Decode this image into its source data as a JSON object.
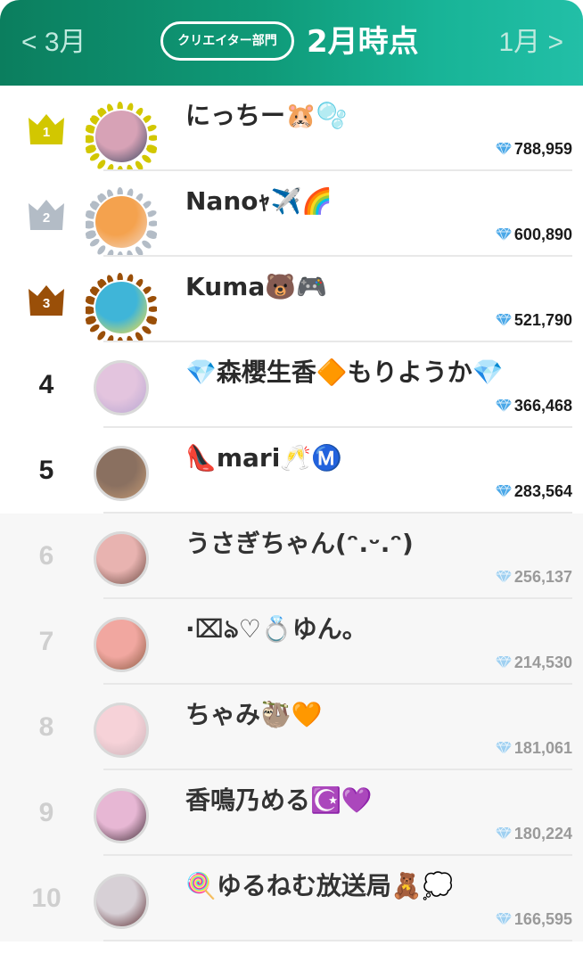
{
  "header": {
    "prev_label": "< 3月",
    "next_label": "1月 >",
    "badge_label": "クリエイター部門",
    "title": "2月時点"
  },
  "colors": {
    "header_gradient_start": "#0b7e5e",
    "header_gradient_end": "#22bfa7",
    "gold": "#d2c700",
    "silver": "#b3bcc6",
    "bronze": "#9a4f08",
    "gem": "#4aa8e8"
  },
  "ranking": [
    {
      "rank": "1",
      "name": "にっちー🐹🫧",
      "score": "788,959",
      "crown": "gold",
      "avatar_colors": [
        "#d7a2b6",
        "#3a4760"
      ]
    },
    {
      "rank": "2",
      "name": "Nanoｬ✈️🌈",
      "score": "600,890",
      "crown": "silver",
      "avatar_colors": [
        "#f4a24e",
        "#f2d7c5"
      ]
    },
    {
      "rank": "3",
      "name": "Kuma🐻🎮",
      "score": "521,790",
      "crown": "bronze",
      "avatar_colors": [
        "#3fb5d8",
        "#ffe23e"
      ]
    },
    {
      "rank": "4",
      "name": "💎森櫻生香🔶もりようか💎",
      "score": "366,468",
      "crown": "",
      "avatar_colors": [
        "#e3c4de",
        "#b7a6d2"
      ]
    },
    {
      "rank": "5",
      "name": "👠mari🥂Ⓜ️",
      "score": "283,564",
      "crown": "",
      "avatar_colors": [
        "#8a7060",
        "#c49a74"
      ]
    },
    {
      "rank": "6",
      "name": "うさぎちゃん(ᵔ.ᵕ.ᵔ)",
      "score": "256,137",
      "crown": "",
      "avatar_colors": [
        "#e8b3b0",
        "#6a4a42"
      ]
    },
    {
      "rank": "7",
      "name": "·⌧ঌ♡💍ゆん。",
      "score": "214,530",
      "crown": "",
      "avatar_colors": [
        "#f1a7a0",
        "#8a5a42"
      ]
    },
    {
      "rank": "8",
      "name": "ちゃみ🦥🧡",
      "score": "181,061",
      "crown": "",
      "avatar_colors": [
        "#f6d2d8",
        "#c9b2b8"
      ]
    },
    {
      "rank": "9",
      "name": "香鳴乃める☪️💜",
      "score": "180,224",
      "crown": "",
      "avatar_colors": [
        "#e7b7d4",
        "#3d2b34"
      ]
    },
    {
      "rank": "10",
      "name": "🍭ゆるねむ放送局🧸💭",
      "score": "166,595",
      "crown": "",
      "avatar_colors": [
        "#d7d0d6",
        "#5a2a2f"
      ]
    }
  ]
}
